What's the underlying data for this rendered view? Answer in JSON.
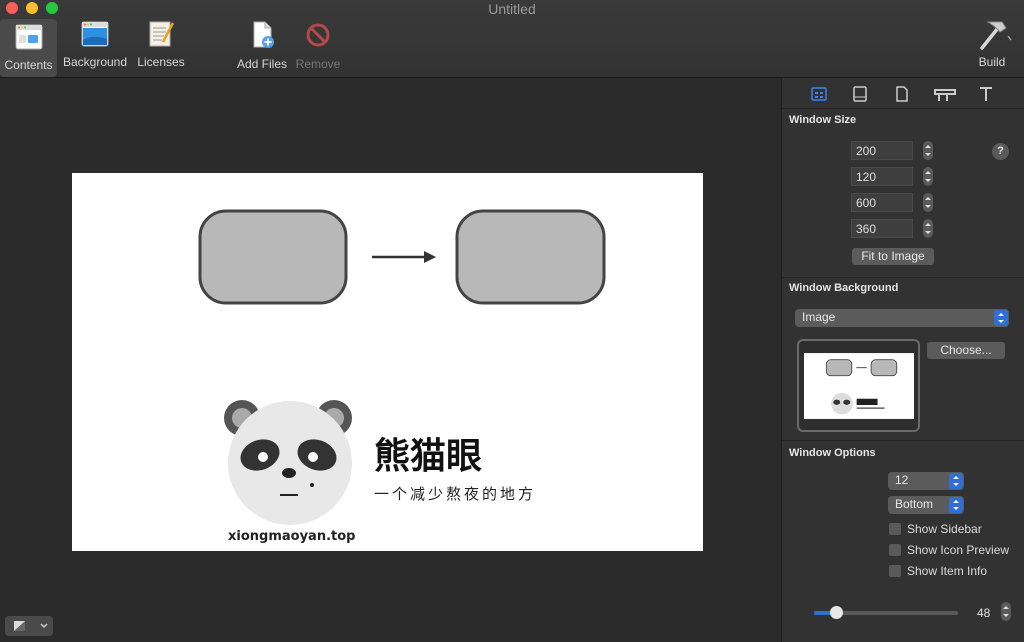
{
  "window": {
    "title": "Untitled"
  },
  "toolbar": {
    "contents": "Contents",
    "background": "Background",
    "licenses": "Licenses",
    "add_files": "Add Files",
    "remove": "Remove",
    "build": "Build"
  },
  "inspector": {
    "window_size": {
      "title": "Window Size",
      "fields": [
        "200",
        "120",
        "600",
        "360"
      ],
      "fit_button": "Fit to Image",
      "help": "?"
    },
    "window_background": {
      "title": "Window Background",
      "type_value": "Image",
      "choose_button": "Choose..."
    },
    "window_options": {
      "title": "Window Options",
      "font_size": "12",
      "label_position": "Bottom",
      "show_sidebar": "Show Sidebar",
      "show_icon_preview": "Show Icon Preview",
      "show_item_info": "Show Item Info",
      "icon_size_value": "48"
    }
  },
  "canvas": {
    "logo_title": "熊猫眼",
    "logo_tagline": "一个减少熬夜的地方",
    "logo_url": "xiongmaoyan.top"
  },
  "colors": {
    "accent": "#2f6fd6",
    "close": "#ff5f57",
    "minimize": "#febc2e",
    "zoom": "#28c840"
  }
}
